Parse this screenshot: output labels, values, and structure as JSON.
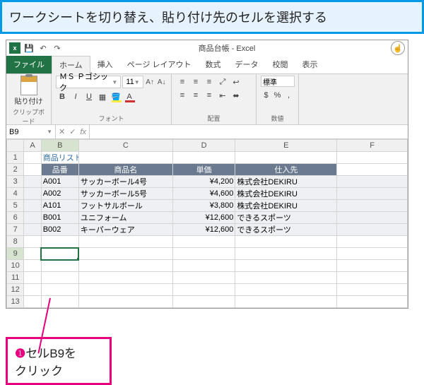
{
  "callout_top": "ワークシートを切り替え、貼り付け先のセルを選択する",
  "callout_bottom": {
    "num": "❶",
    "text": "セルB9を\nクリック"
  },
  "titlebar": {
    "title": "商品台帳 - Excel"
  },
  "tabs": {
    "file": "ファイル",
    "home": "ホーム",
    "insert": "挿入",
    "page_layout": "ページ レイアウト",
    "formulas": "数式",
    "data": "データ",
    "review": "校閲",
    "view": "表示"
  },
  "ribbon": {
    "clipboard": {
      "paste_label": "貼り付け",
      "group_label": "クリップボード"
    },
    "font": {
      "name": "ＭＳ Ｐゴシック",
      "size": "11",
      "group_label": "フォント"
    },
    "alignment": {
      "group_label": "配置"
    },
    "number": {
      "format": "標準",
      "group_label": "数値"
    }
  },
  "name_box": "B9",
  "columns": [
    "",
    "A",
    "B",
    "C",
    "D",
    "E",
    "F"
  ],
  "rows": [
    {
      "r": 1,
      "cells": [
        "",
        "商品リスト",
        "",
        "",
        "",
        ""
      ],
      "title_row": true
    },
    {
      "r": 2,
      "cells": [
        "",
        "品番",
        "商品名",
        "単価",
        "仕入先",
        ""
      ],
      "header_row": true
    },
    {
      "r": 3,
      "cells": [
        "",
        "A001",
        "サッカーボール4号",
        "¥4,200",
        "株式会社DEKIRU",
        ""
      ],
      "data_row": true
    },
    {
      "r": 4,
      "cells": [
        "",
        "A002",
        "サッカーボール5号",
        "¥4,600",
        "株式会社DEKIRU",
        ""
      ],
      "data_row": true
    },
    {
      "r": 5,
      "cells": [
        "",
        "A101",
        "フットサルボール",
        "¥3,800",
        "株式会社DEKIRU",
        ""
      ],
      "data_row": true
    },
    {
      "r": 6,
      "cells": [
        "",
        "B001",
        "ユニフォーム",
        "¥12,600",
        "できるスポーツ",
        ""
      ],
      "data_row": true
    },
    {
      "r": 7,
      "cells": [
        "",
        "B002",
        "キーパーウェア",
        "¥12,600",
        "できるスポーツ",
        ""
      ],
      "data_row": true
    },
    {
      "r": 8,
      "cells": [
        "",
        "",
        "",
        "",
        "",
        ""
      ]
    },
    {
      "r": 9,
      "cells": [
        "",
        "",
        "",
        "",
        "",
        ""
      ],
      "selected_col": 1
    },
    {
      "r": 10,
      "cells": [
        "",
        "",
        "",
        "",
        "",
        ""
      ]
    },
    {
      "r": 11,
      "cells": [
        "",
        "",
        "",
        "",
        "",
        ""
      ]
    },
    {
      "r": 12,
      "cells": [
        "",
        "",
        "",
        "",
        "",
        ""
      ]
    },
    {
      "r": 13,
      "cells": [
        "",
        "",
        "",
        "",
        "",
        ""
      ]
    }
  ],
  "selected": {
    "col_header": "B",
    "row_header": 9
  }
}
